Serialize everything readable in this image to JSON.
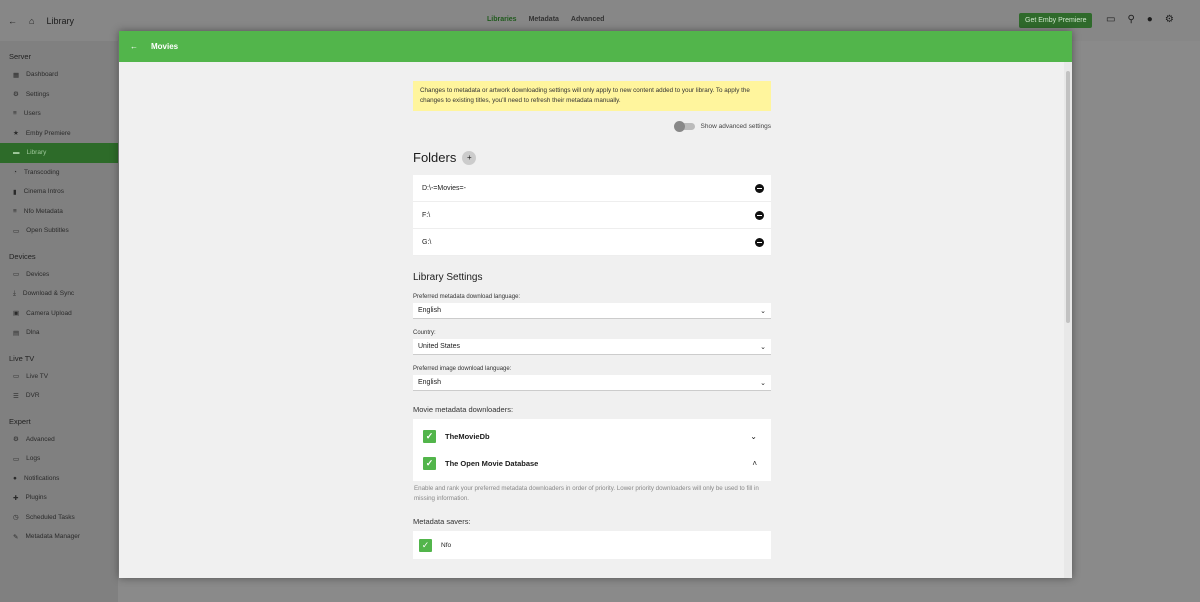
{
  "header": {
    "title": "Library",
    "tabs": [
      "Libraries",
      "Metadata",
      "Advanced"
    ],
    "premium": "Get Emby Premiere"
  },
  "sidebar": [
    {
      "section": "Server",
      "items": [
        "Dashboard",
        "Settings",
        "Users",
        "Emby Premiere",
        "Library",
        "Transcoding",
        "Cinema Intros",
        "Nfo Metadata",
        "Open Subtitles"
      ]
    },
    {
      "section": "Devices",
      "items": [
        "Devices",
        "Download & Sync",
        "Camera Upload",
        "Dlna"
      ]
    },
    {
      "section": "Live TV",
      "items": [
        "Live TV",
        "DVR"
      ]
    },
    {
      "section": "Expert",
      "items": [
        "Advanced",
        "Logs",
        "Notifications",
        "Plugins",
        "Scheduled Tasks",
        "Metadata Manager"
      ]
    }
  ],
  "dialog": {
    "title": "Movies",
    "warning": "Changes to metadata or artwork downloading settings will only apply to new content added to your library. To apply the changes to existing titles, you'll need to refresh their metadata manually.",
    "advanced_toggle": "Show advanced settings",
    "folders_title": "Folders",
    "add": "+",
    "folders": [
      "D:\\-=Movies=-",
      "F:\\",
      "G:\\"
    ],
    "library_settings": "Library Settings",
    "lang_label": "Preferred metadata download language:",
    "lang_value": "English",
    "country_label": "Country:",
    "country_value": "United States",
    "img_label": "Preferred image download language:",
    "img_value": "English",
    "downloaders_label": "Movie metadata downloaders:",
    "downloaders": [
      "TheMovieDb",
      "The Open Movie Database"
    ],
    "downloaders_hint": "Enable and rank your preferred metadata downloaders in order of priority. Lower priority downloaders will only be used to fill in missing information.",
    "savers_label": "Metadata savers:",
    "savers": [
      "Nfo"
    ]
  }
}
